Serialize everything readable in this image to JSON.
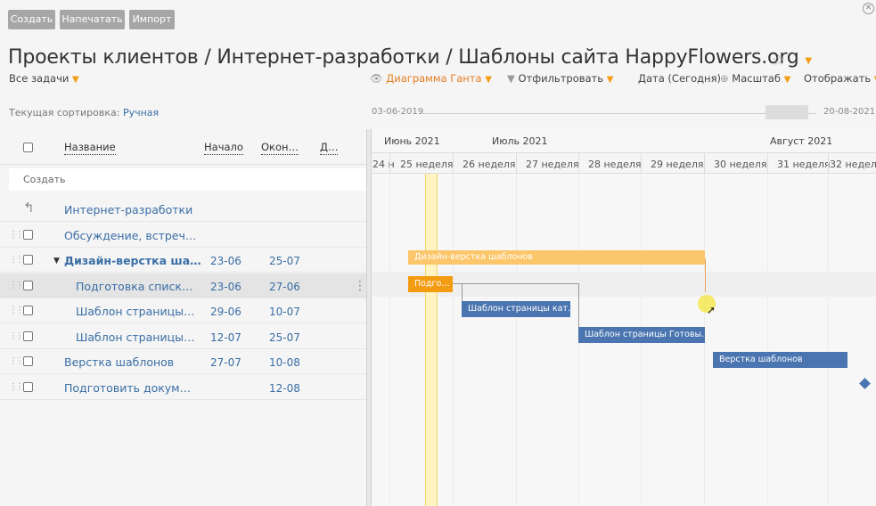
{
  "toolbar": {
    "create": "Создать",
    "print": "Напечатать",
    "import": "Импорт"
  },
  "title": "Проекты клиентов / Интернет-разработки / Шаблоны сайта HappyFlowers.org",
  "filter_bar": {
    "all_tasks": "Все задачи",
    "gantt": "Диаграмма Ганта",
    "filter": "Отфильтровать",
    "date": "Дата (Сегодня)",
    "scale": "Масштаб",
    "display": "Отображать"
  },
  "sorting": {
    "label": "Текущая сортировка:",
    "value": "Ручная"
  },
  "range": {
    "start": "03-06-2019",
    "end": "20-08-2021"
  },
  "columns": {
    "name": "Название",
    "start": "Начало",
    "end": "Окон…",
    "dur": "Д…"
  },
  "create_row": "Создать",
  "rows": [
    {
      "name": "Интернет-разработки",
      "start": "",
      "end": ""
    },
    {
      "name": "Обсуждение, встреч…",
      "start": "",
      "end": ""
    },
    {
      "name": "Дизайн-верстка ша…",
      "start": "23-06",
      "end": "25-07"
    },
    {
      "name": "Подготовка списк…",
      "start": "23-06",
      "end": "27-06"
    },
    {
      "name": "Шаблон страницы…",
      "start": "29-06",
      "end": "10-07"
    },
    {
      "name": "Шаблон страницы…",
      "start": "12-07",
      "end": "25-07"
    },
    {
      "name": "Верстка шаблонов",
      "start": "27-07",
      "end": "10-08"
    },
    {
      "name": "Подготовить докум…",
      "start": "",
      "end": "12-08"
    }
  ],
  "gantt": {
    "months": [
      "Июнь 2021",
      "Июль 2021",
      "Август 2021"
    ],
    "weeks": [
      "24 н",
      "25 неделя",
      "26 неделя",
      "27 неделя",
      "28 неделя",
      "29 неделя",
      "30 неделя",
      "31 неделя",
      "32 неделя"
    ],
    "bars": {
      "summary": "Дизайн-верстка шаблонов",
      "prep": "Подго…",
      "tpl1": "Шаблон страницы кат…",
      "tpl2": "Шаблон страницы Готовы…",
      "layout": "Верстка шаблонов"
    }
  },
  "colors": {
    "accent": "#e67e22",
    "bar_blue": "#4a75b0",
    "link": "#3a6ea5"
  }
}
